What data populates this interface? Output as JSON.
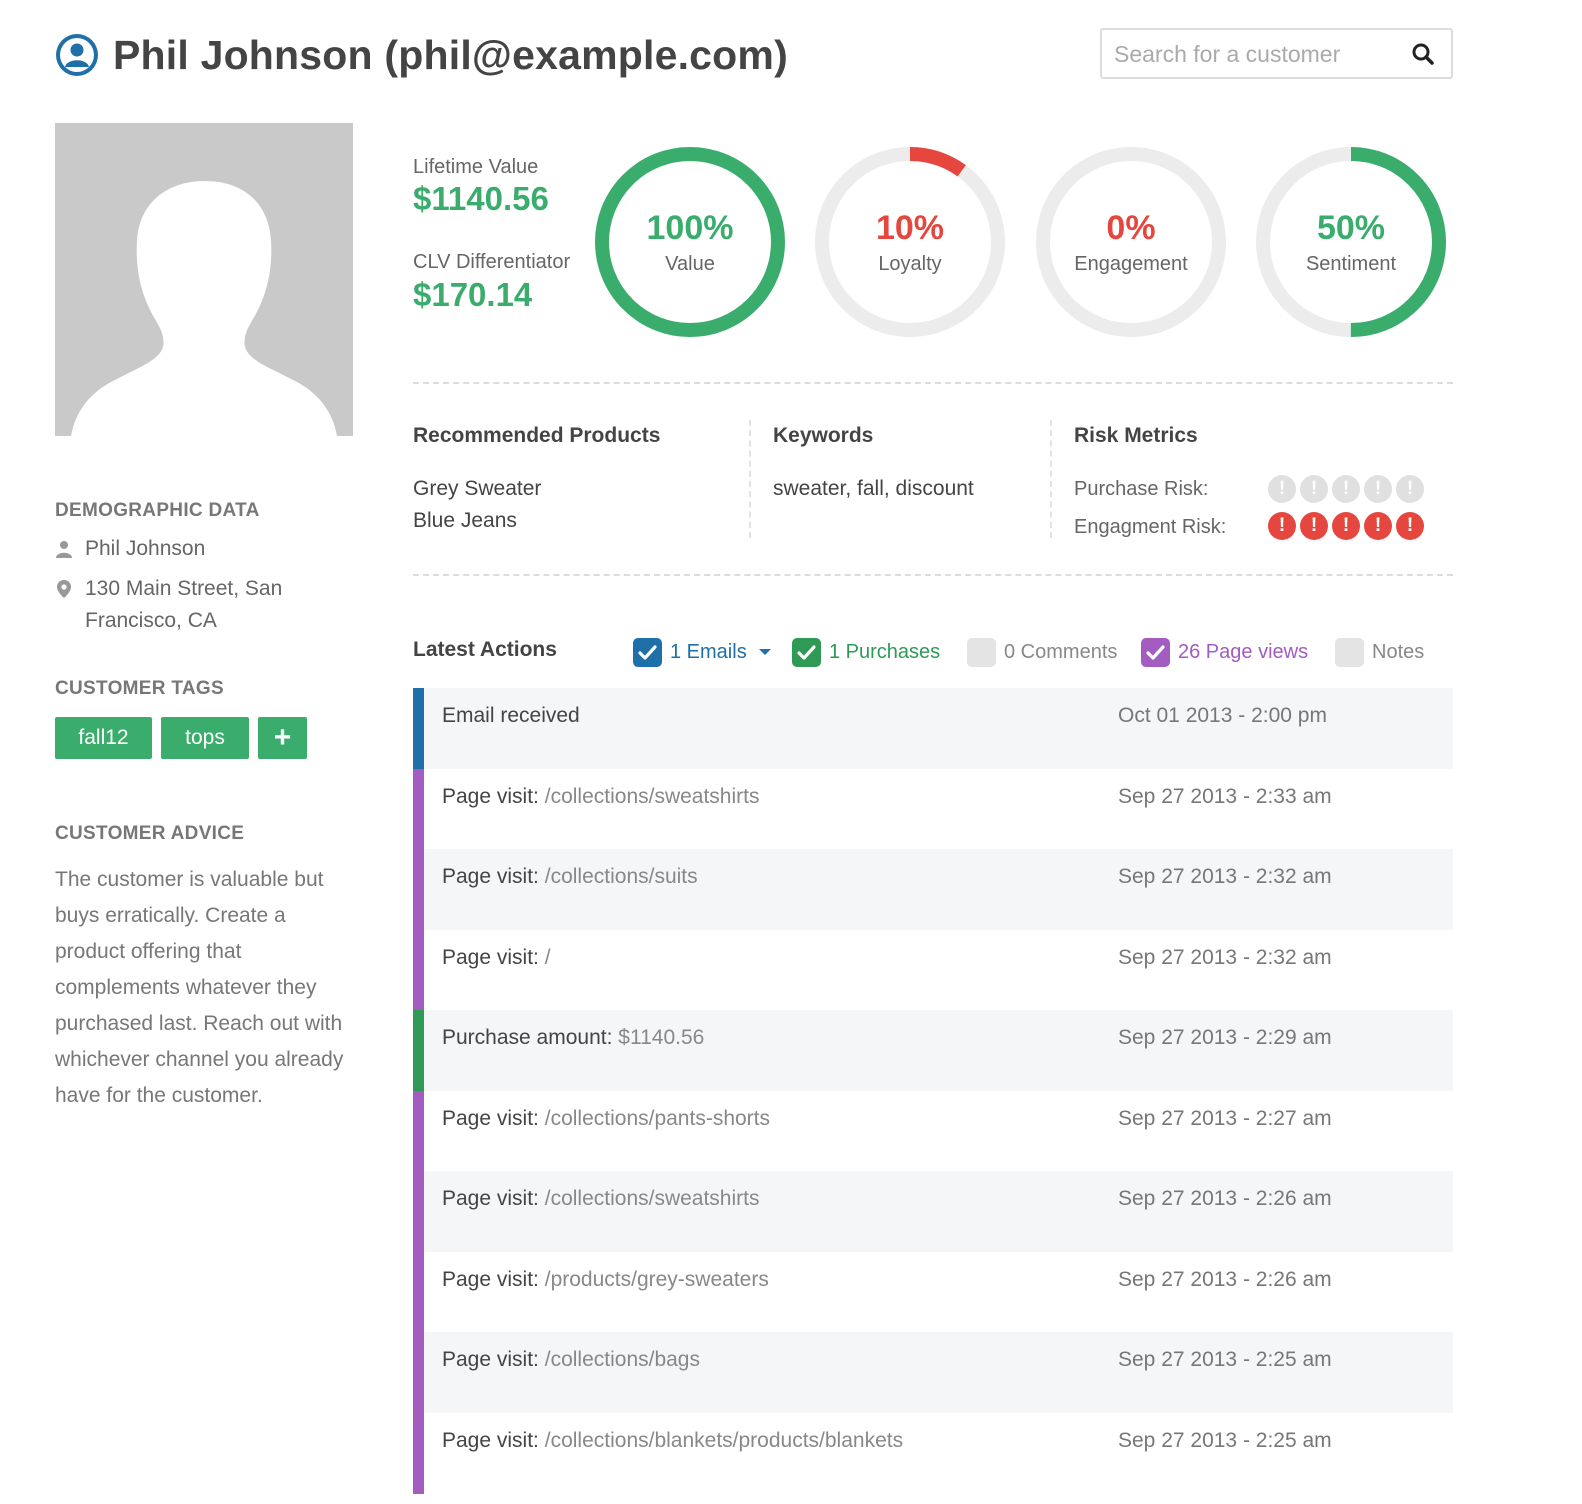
{
  "header": {
    "title": "Phil Johnson (phil@example.com)",
    "search_placeholder": "Search for a customer"
  },
  "demographic": {
    "title": "DEMOGRAPHIC DATA",
    "name": "Phil Johnson",
    "address": "130 Main Street, San Francisco, CA"
  },
  "tags": {
    "title": "CUSTOMER TAGS",
    "items": [
      "fall12",
      "tops"
    ],
    "add_label": "+"
  },
  "advice": {
    "title": "CUSTOMER ADVICE",
    "text": "The customer is valuable but buys erratically. Create a product offering that complements whatever they purchased last. Reach out with whichever channel you already have for the customer."
  },
  "stats": {
    "lifetime_label": "Lifetime Value",
    "lifetime_value": "$1140.56",
    "clv_label": "CLV Differentiator",
    "clv_value": "$170.14"
  },
  "gauges": [
    {
      "pct_text": "100%",
      "label": "Value",
      "fraction": 1.0,
      "color": "#3aad6d"
    },
    {
      "pct_text": "10%",
      "label": "Loyalty",
      "fraction": 0.1,
      "color": "#e5473f"
    },
    {
      "pct_text": "0%",
      "label": "Engagement",
      "fraction": 0.0,
      "color": "#e5473f"
    },
    {
      "pct_text": "50%",
      "label": "Sentiment",
      "fraction": 0.5,
      "color": "#3aad6d"
    }
  ],
  "recommended": {
    "title": "Recommended Products",
    "items": [
      "Grey Sweater",
      "Blue Jeans"
    ]
  },
  "keywords": {
    "title": "Keywords",
    "text": "sweater, fall, discount"
  },
  "risk": {
    "title": "Risk Metrics",
    "purchase_label": "Purchase Risk:",
    "purchase_level": 0,
    "engagement_label": "Engagment Risk:",
    "engagement_level": 5,
    "dot_glyph": "!"
  },
  "latest_actions": {
    "title": "Latest Actions",
    "filters": [
      {
        "label": "1 Emails",
        "checked": true,
        "color": "#1f6fa8",
        "dropdown": true
      },
      {
        "label": "1 Purchases",
        "checked": true,
        "color": "#2e9a55",
        "dropdown": false
      },
      {
        "label": "0 Comments",
        "checked": false,
        "color": "#888888",
        "dropdown": false
      },
      {
        "label": "26 Page views",
        "checked": true,
        "color": "#a35cc0",
        "dropdown": false
      },
      {
        "label": "Notes",
        "checked": false,
        "color": "#888888",
        "dropdown": false
      }
    ],
    "items": [
      {
        "type": "email",
        "prefix": "Email received",
        "detail": "",
        "time": "Oct 01 2013 - 2:00 pm"
      },
      {
        "type": "page",
        "prefix": "Page visit:",
        "detail": "/collections/sweatshirts",
        "time": "Sep 27 2013 - 2:33 am"
      },
      {
        "type": "page",
        "prefix": "Page visit:",
        "detail": "/collections/suits",
        "time": "Sep 27 2013 - 2:32 am"
      },
      {
        "type": "page",
        "prefix": "Page visit:",
        "detail": "/",
        "time": "Sep 27 2013 - 2:32 am"
      },
      {
        "type": "purchase",
        "prefix": "Purchase amount:",
        "detail": "$1140.56",
        "time": "Sep 27 2013 - 2:29 am"
      },
      {
        "type": "page",
        "prefix": "Page visit:",
        "detail": "/collections/pants-shorts",
        "time": "Sep 27 2013 - 2:27 am"
      },
      {
        "type": "page",
        "prefix": "Page visit:",
        "detail": "/collections/sweatshirts",
        "time": "Sep 27 2013 - 2:26 am"
      },
      {
        "type": "page",
        "prefix": "Page visit:",
        "detail": "/products/grey-sweaters",
        "time": "Sep 27 2013 - 2:26 am"
      },
      {
        "type": "page",
        "prefix": "Page visit:",
        "detail": "/collections/bags",
        "time": "Sep 27 2013 - 2:25 am"
      },
      {
        "type": "page",
        "prefix": "Page visit:",
        "detail": "/collections/blankets/products/blankets",
        "time": "Sep 27 2013 - 2:25 am"
      }
    ],
    "type_colors": {
      "email": "#1f6fa8",
      "page": "#a35cc0",
      "purchase": "#2e9a55"
    }
  },
  "colors": {
    "accent_green": "#3aad6d",
    "danger_red": "#e5473f",
    "track_grey": "#ececec",
    "inactive_dot": "#e0e0e0"
  }
}
